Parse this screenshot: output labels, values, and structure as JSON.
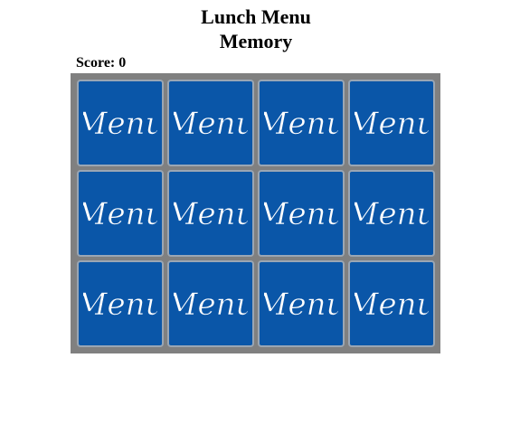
{
  "page": {
    "title_line1": "Lunch Menu",
    "title_line2": "Memory",
    "score_label": "Score:",
    "score_value": "0"
  },
  "board": {
    "rows": 3,
    "columns": 4,
    "card_back_text": "Menu",
    "cards": [
      {
        "state": "face-down"
      },
      {
        "state": "face-down"
      },
      {
        "state": "face-down"
      },
      {
        "state": "face-down"
      },
      {
        "state": "face-down"
      },
      {
        "state": "face-down"
      },
      {
        "state": "face-down"
      },
      {
        "state": "face-down"
      },
      {
        "state": "face-down"
      },
      {
        "state": "face-down"
      },
      {
        "state": "face-down"
      },
      {
        "state": "face-down"
      }
    ]
  },
  "colors": {
    "card_back": "#0a56a8",
    "card_border": "#9aa6b4",
    "board_frame": "#808080",
    "script_text": "#ffffff"
  },
  "icons": {
    "card_back": "menu-script-icon"
  }
}
